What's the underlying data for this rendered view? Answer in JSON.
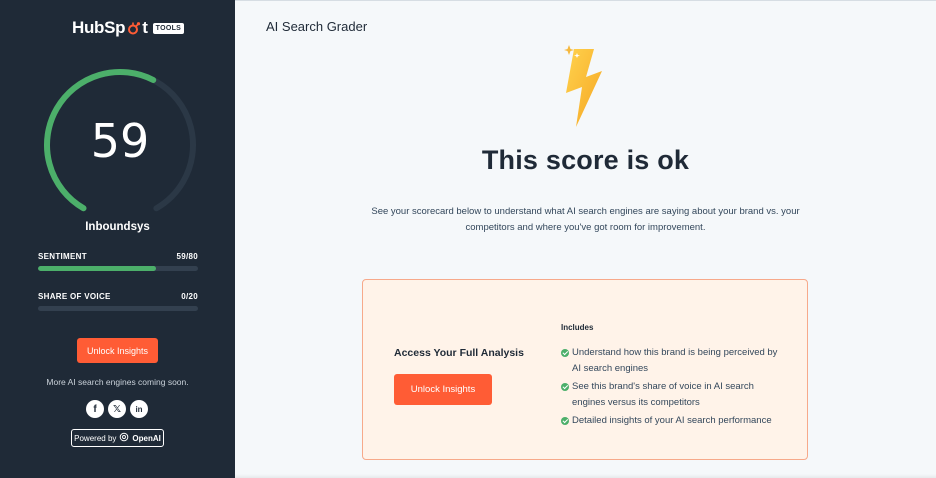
{
  "sidebar": {
    "logo_text_before": "HubSp",
    "logo_text_after": "t",
    "tools_badge": "TOOLS",
    "score": "59",
    "score_fraction": 0.59,
    "brand_name": "Inboundsys",
    "metrics": [
      {
        "label": "SENTIMENT",
        "value": "59/80",
        "fill_fraction": 0.7375
      },
      {
        "label": "SHARE OF VOICE",
        "value": "0/20",
        "fill_fraction": 0
      }
    ],
    "unlock_button": "Unlock Insights",
    "coming_soon": "More AI search engines coming soon.",
    "socials": [
      {
        "icon": "facebook-icon",
        "glyph": "f"
      },
      {
        "icon": "x-icon",
        "glyph": "𝕏"
      },
      {
        "icon": "linkedin-icon",
        "glyph": "in"
      }
    ],
    "powered_by": "Powered by",
    "powered_brand": "OpenAI"
  },
  "main": {
    "page_title": "AI Search Grader",
    "headline": "This score is ok",
    "description": "See your scorecard below to understand what AI search engines are saying about your brand vs. your competitors and where you've got room for improvement.",
    "card": {
      "title": "Access Your Full Analysis",
      "button": "Unlock Insights",
      "includes_label": "Includes",
      "features": [
        "Understand how this brand is being perceived by AI search engines",
        "See this brand's share of voice in AI search engines versus its competitors",
        "Detailed insights of your AI search performance"
      ]
    }
  },
  "colors": {
    "sidebar_bg": "#1f2a37",
    "accent_orange": "#ff5c35",
    "gauge_green": "#4caf6a",
    "gauge_track": "#2b3846",
    "card_bg": "#fff3e9",
    "card_border": "#f7a98a"
  }
}
